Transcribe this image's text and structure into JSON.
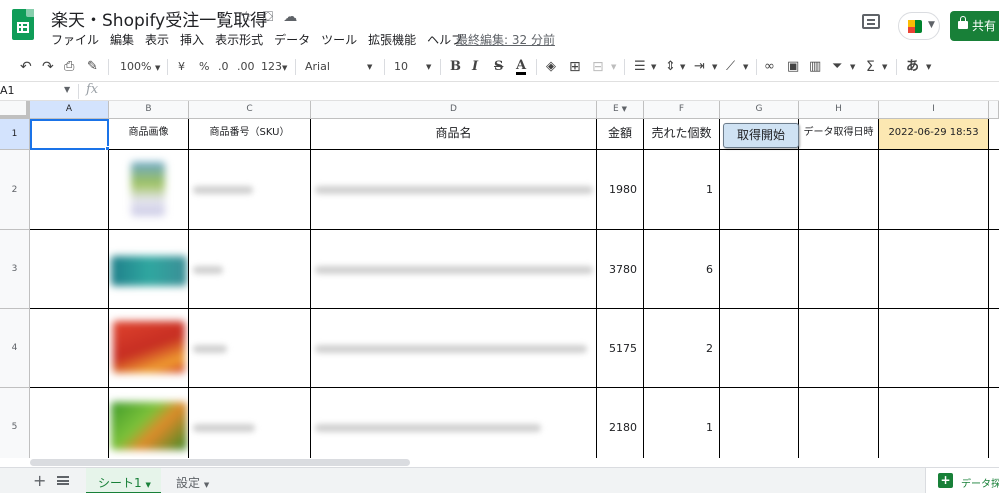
{
  "header": {
    "title": "楽天・Shopify受注一覧取得",
    "menu": [
      "ファイル",
      "編集",
      "表示",
      "挿入",
      "表示形式",
      "データ",
      "ツール",
      "拡張機能",
      "ヘルプ"
    ],
    "last_edit": "最終編集: 32 分前",
    "share_label": "共有"
  },
  "toolbar": {
    "zoom": "100%",
    "currency": "¥",
    "percent": "%",
    "dec_decrease": ".0",
    "dec_increase": ".00",
    "format_123": "123",
    "font": "Arial",
    "font_size": "10",
    "bold": "B",
    "italic": "I",
    "strike": "S",
    "text_color": "A",
    "input_tool": "あ"
  },
  "formula_bar": {
    "cell_ref": "A1",
    "fx": "fx"
  },
  "columns": [
    "A",
    "B",
    "C",
    "D",
    "E",
    "F",
    "G",
    "H",
    "I"
  ],
  "rows": [
    "1",
    "2",
    "3",
    "4",
    "5"
  ],
  "sheet": {
    "headers": {
      "image": "商品画像",
      "sku": "商品番号（SKU）",
      "name": "商品名",
      "price": "金額",
      "qty": "売れた個数",
      "fetch_button": "取得開始",
      "fetch_time_label": "データ取得日時",
      "fetch_time": "2022-06-29 18:53"
    },
    "data": [
      {
        "price": "1980",
        "qty": "1"
      },
      {
        "price": "3780",
        "qty": "6"
      },
      {
        "price": "5175",
        "qty": "2"
      },
      {
        "price": "2180",
        "qty": "1"
      }
    ]
  },
  "tabs": [
    "シート1",
    "設定"
  ],
  "explore_label": "データ探索",
  "colors": {
    "accent": "#188038",
    "selection": "#1a73e8",
    "date_fill": "#fce8b2",
    "button_fill": "#cfe2f3"
  }
}
